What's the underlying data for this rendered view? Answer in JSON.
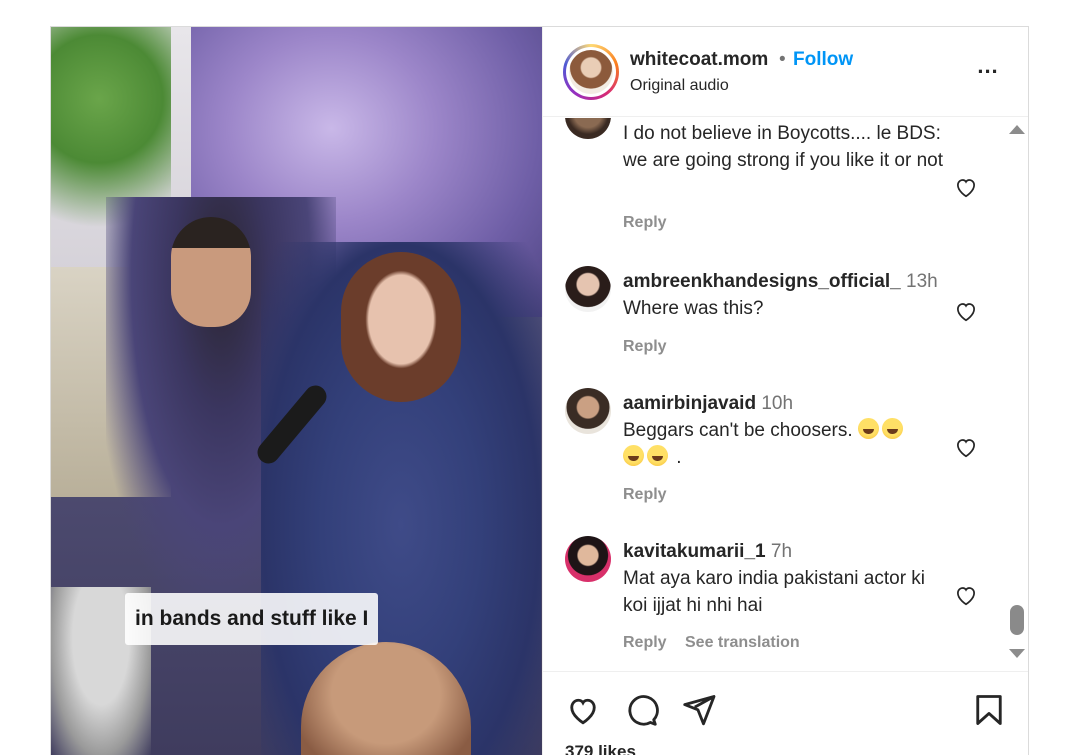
{
  "post": {
    "media": {
      "caption": "in bands and stuff like I"
    },
    "header": {
      "username": "whitecoat.mom",
      "separator": "•",
      "follow_label": "Follow",
      "audio": "Original audio",
      "more_label": "..."
    },
    "comments": [
      {
        "text": "I do not believe in Boycotts.... le BDS: we are going strong if you like it or not",
        "reply": "Reply"
      },
      {
        "username": "ambreenkhandesigns_official_",
        "time": "13h",
        "text": "Where was this?",
        "reply": "Reply"
      },
      {
        "username": "aamirbinjavaid",
        "time": "10h",
        "text": "Beggars can't be choosers.",
        "text_tail": ".",
        "reply": "Reply"
      },
      {
        "username": "kavitakumarii_1",
        "time": "7h",
        "text": "Mat aya karo india pakistani actor ki koi ijjat hi nhi hai",
        "reply": "Reply",
        "translation": "See translation"
      }
    ],
    "actions": {
      "icons": [
        "heart-icon",
        "comment-icon",
        "share-icon",
        "bookmark-icon"
      ],
      "likes_text": "379 likes"
    },
    "colors": {
      "follow": "#0095f6",
      "muted": "#8e8e8e",
      "text": "#262626"
    }
  }
}
